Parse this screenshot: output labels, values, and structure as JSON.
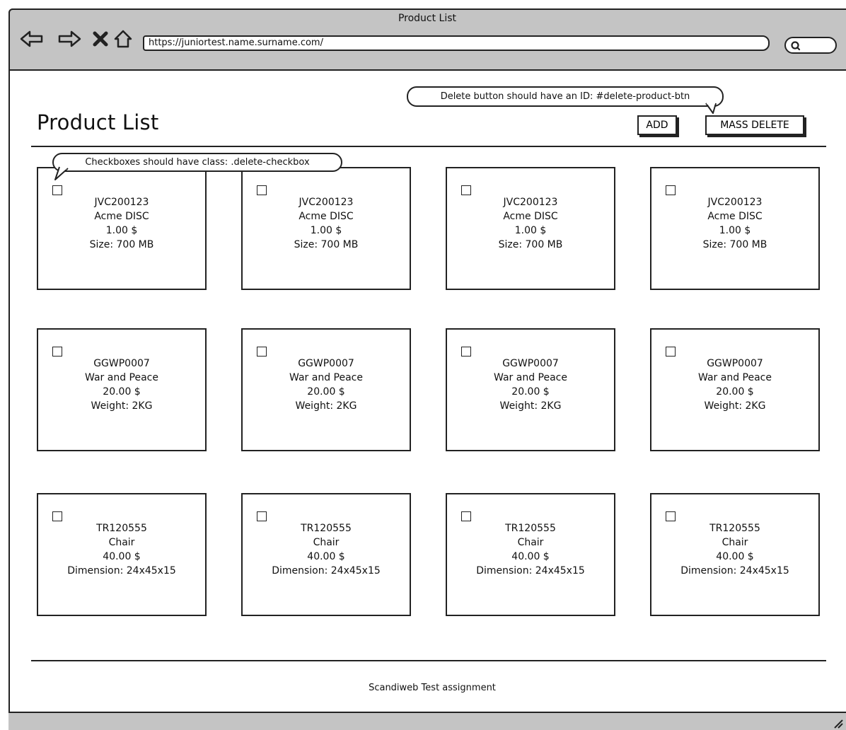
{
  "window": {
    "title": "Product List",
    "url": "https://juniortest.name.surname.com/",
    "nav_icons": [
      "back-arrow-icon",
      "forward-arrow-icon",
      "close-x-icon",
      "home-icon"
    ]
  },
  "header": {
    "title": "Product List",
    "add_label": "ADD",
    "mass_delete_label": "MASS DELETE"
  },
  "annotations": {
    "delete_note": "Delete button should have an ID: #delete-product-btn",
    "checkbox_note": "Checkboxes should have class: .delete-checkbox"
  },
  "products": [
    {
      "sku": "JVC200123",
      "name": "Acme DISC",
      "price": "1.00 $",
      "attribute": "Size: 700 MB",
      "checked": false
    },
    {
      "sku": "JVC200123",
      "name": "Acme DISC",
      "price": "1.00 $",
      "attribute": "Size: 700 MB",
      "checked": false
    },
    {
      "sku": "JVC200123",
      "name": "Acme DISC",
      "price": "1.00 $",
      "attribute": "Size: 700 MB",
      "checked": false
    },
    {
      "sku": "JVC200123",
      "name": "Acme DISC",
      "price": "1.00 $",
      "attribute": "Size: 700 MB",
      "checked": false
    },
    {
      "sku": "GGWP0007",
      "name": "War and Peace",
      "price": "20.00 $",
      "attribute": "Weight: 2KG",
      "checked": false
    },
    {
      "sku": "GGWP0007",
      "name": "War and Peace",
      "price": "20.00 $",
      "attribute": "Weight: 2KG",
      "checked": false
    },
    {
      "sku": "GGWP0007",
      "name": "War and Peace",
      "price": "20.00 $",
      "attribute": "Weight: 2KG",
      "checked": false
    },
    {
      "sku": "GGWP0007",
      "name": "War and Peace",
      "price": "20.00 $",
      "attribute": "Weight: 2KG",
      "checked": false
    },
    {
      "sku": "TR120555",
      "name": "Chair",
      "price": "40.00 $",
      "attribute": "Dimension: 24x45x15",
      "checked": false
    },
    {
      "sku": "TR120555",
      "name": "Chair",
      "price": "40.00 $",
      "attribute": "Dimension: 24x45x15",
      "checked": false
    },
    {
      "sku": "TR120555",
      "name": "Chair",
      "price": "40.00 $",
      "attribute": "Dimension: 24x45x15",
      "checked": false
    },
    {
      "sku": "TR120555",
      "name": "Chair",
      "price": "40.00 $",
      "attribute": "Dimension: 24x45x15",
      "checked": false
    }
  ],
  "footer": {
    "text": "Scandiweb Test assignment"
  }
}
